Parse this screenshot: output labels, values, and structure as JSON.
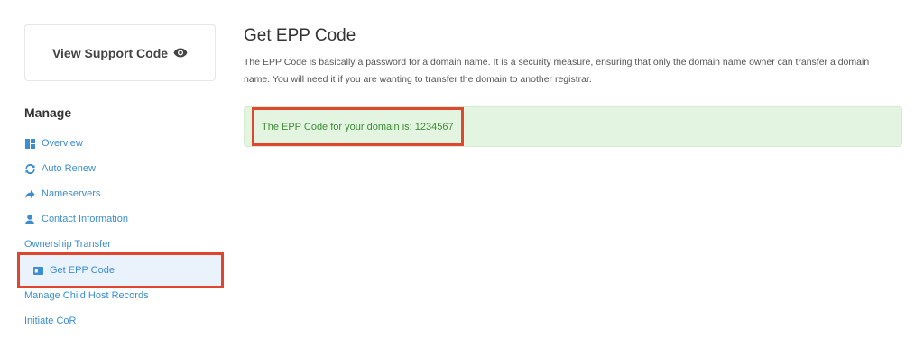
{
  "sidebar": {
    "support_button_label": "View Support Code",
    "manage_heading": "Manage",
    "items": [
      {
        "label": "Overview",
        "icon": "dashboard-icon"
      },
      {
        "label": "Auto Renew",
        "icon": "sync-icon"
      },
      {
        "label": "Nameservers",
        "icon": "arrow-right-icon"
      },
      {
        "label": "Contact Information",
        "icon": "user-icon"
      },
      {
        "label": "Ownership Transfer",
        "icon": ""
      },
      {
        "label": "Get EPP Code",
        "icon": "id-card-icon"
      },
      {
        "label": "Manage Child Host Records",
        "icon": ""
      },
      {
        "label": "Initiate CoR",
        "icon": ""
      }
    ]
  },
  "main": {
    "title": "Get EPP Code",
    "description": "The EPP Code is basically a password for a domain name. It is a security measure, ensuring that only the domain name owner can transfer a domain name. You will need it if you are wanting to transfer the domain to another registrar.",
    "alert_text": "The EPP Code for your domain is: 1234567"
  },
  "colors": {
    "link": "#3c8ed0",
    "highlight_outline": "#e0452d",
    "success_bg": "#e3f4e1",
    "success_text": "#3e8c35"
  }
}
